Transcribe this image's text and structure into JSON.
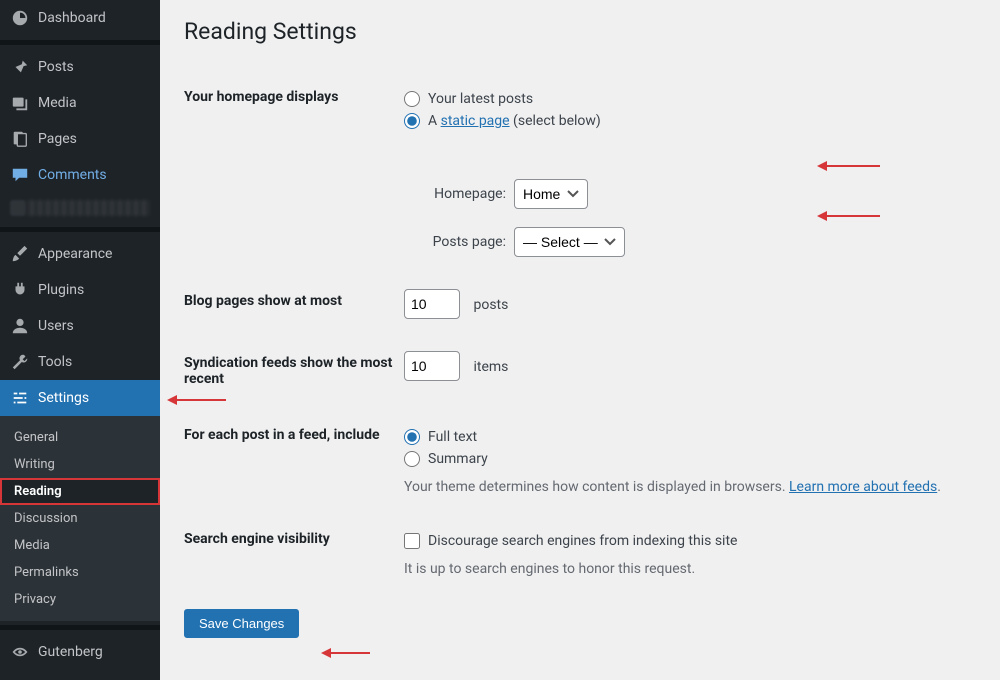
{
  "sidebar": {
    "items": [
      {
        "label": "Dashboard"
      },
      {
        "label": "Posts"
      },
      {
        "label": "Media"
      },
      {
        "label": "Pages"
      },
      {
        "label": "Comments"
      },
      {
        "label": "Appearance"
      },
      {
        "label": "Plugins"
      },
      {
        "label": "Users"
      },
      {
        "label": "Tools"
      },
      {
        "label": "Settings"
      },
      {
        "label": "Gutenberg"
      }
    ],
    "submenu": {
      "general": "General",
      "writing": "Writing",
      "reading": "Reading",
      "discussion": "Discussion",
      "media": "Media",
      "permalinks": "Permalinks",
      "privacy": "Privacy"
    }
  },
  "page": {
    "title": "Reading Settings"
  },
  "homepage_displays": {
    "heading": "Your homepage displays",
    "option_latest": "Your latest posts",
    "option_static_prefix": "A ",
    "option_static_link": "static page",
    "option_static_suffix": " (select below)",
    "homepage_label": "Homepage:",
    "homepage_value": "Home",
    "posts_page_label": "Posts page:",
    "posts_page_value": "— Select —"
  },
  "blog_pages": {
    "heading": "Blog pages show at most",
    "value": "10",
    "unit": "posts"
  },
  "syndication": {
    "heading": "Syndication feeds show the most recent",
    "value": "10",
    "unit": "items"
  },
  "feed_include": {
    "heading": "For each post in a feed, include",
    "option_full": "Full text",
    "option_summary": "Summary",
    "desc_prefix": "Your theme determines how content is displayed in browsers. ",
    "learn_link": "Learn more about feeds",
    "desc_suffix": "."
  },
  "search_engine": {
    "heading": "Search engine visibility",
    "checkbox_label": "Discourage search engines from indexing this site",
    "note": "It is up to search engines to honor this request."
  },
  "button_save": "Save Changes"
}
